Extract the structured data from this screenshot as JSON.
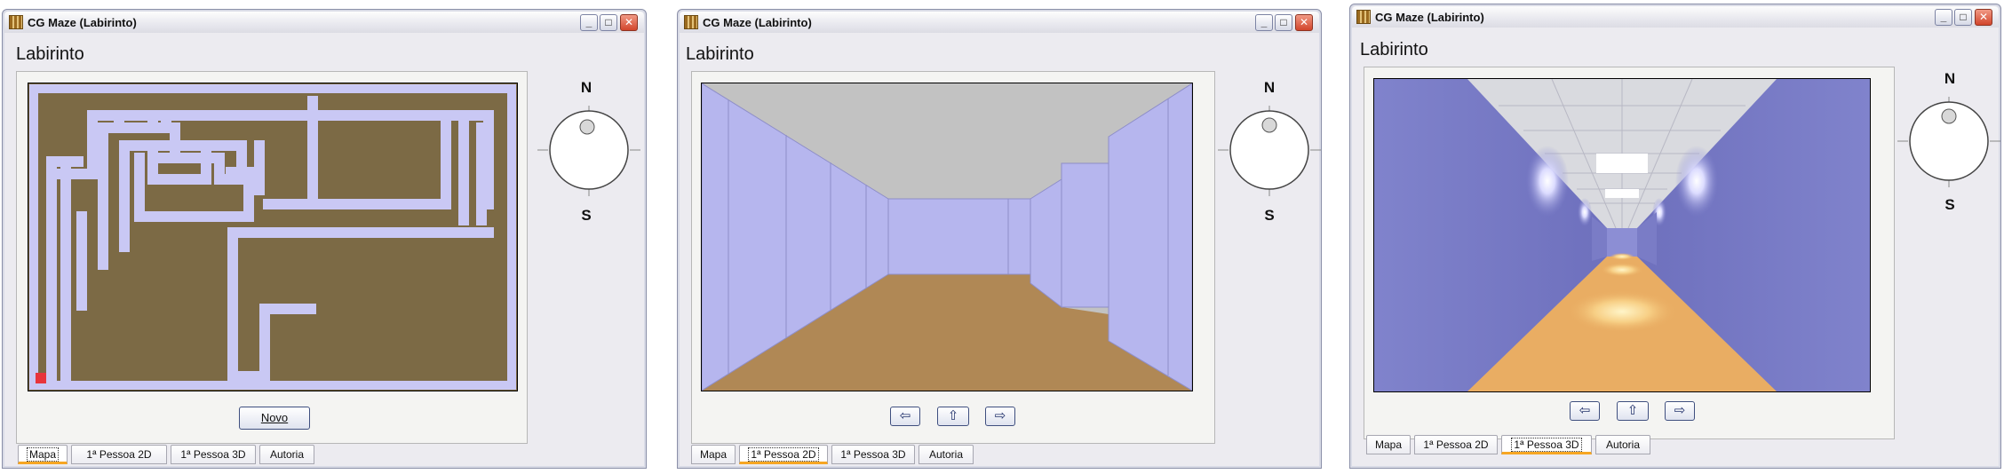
{
  "windows": [
    {
      "title": "CG Maze (Labirinto)",
      "heading": "Labirinto",
      "view": "map",
      "new_button": "Novo",
      "compass": {
        "north": "N",
        "south": "S"
      },
      "tabs": [
        {
          "label": "Mapa",
          "selected": true
        },
        {
          "label": "1ª Pessoa 2D",
          "selected": false
        },
        {
          "label": "1ª Pessoa 3D",
          "selected": false
        },
        {
          "label": "Autoria",
          "selected": false
        }
      ]
    },
    {
      "title": "CG Maze (Labirinto)",
      "heading": "Labirinto",
      "view": "2d",
      "nav": {
        "left": "left-arrow-icon",
        "forward": "up-arrow-icon",
        "right": "right-arrow-icon"
      },
      "compass": {
        "north": "N",
        "south": "S"
      },
      "tabs": [
        {
          "label": "Mapa",
          "selected": false
        },
        {
          "label": "1ª Pessoa 2D",
          "selected": true
        },
        {
          "label": "1ª Pessoa 3D",
          "selected": false
        },
        {
          "label": "Autoria",
          "selected": false
        }
      ]
    },
    {
      "title": "CG Maze (Labirinto)",
      "heading": "Labirinto",
      "view": "3d",
      "nav": {
        "left": "left-arrow-icon",
        "forward": "up-arrow-icon",
        "right": "right-arrow-icon"
      },
      "compass": {
        "north": "N",
        "south": "S"
      },
      "tabs": [
        {
          "label": "Mapa",
          "selected": false
        },
        {
          "label": "1ª Pessoa 2D",
          "selected": false
        },
        {
          "label": "1ª Pessoa 3D",
          "selected": true
        },
        {
          "label": "Autoria",
          "selected": false
        }
      ]
    }
  ],
  "colors": {
    "maze_floor": "#7C6A45",
    "maze_wall": "#C9C8F4",
    "player": "#E8343C",
    "wall_2d": "#B6B6EE",
    "ceiling_2d": "#C2C2C2",
    "floor_2d": "#B08855",
    "wall_3d": "#8587CE",
    "floor_3d": "#E9AD63",
    "tab_highlight": "#F6A623"
  }
}
